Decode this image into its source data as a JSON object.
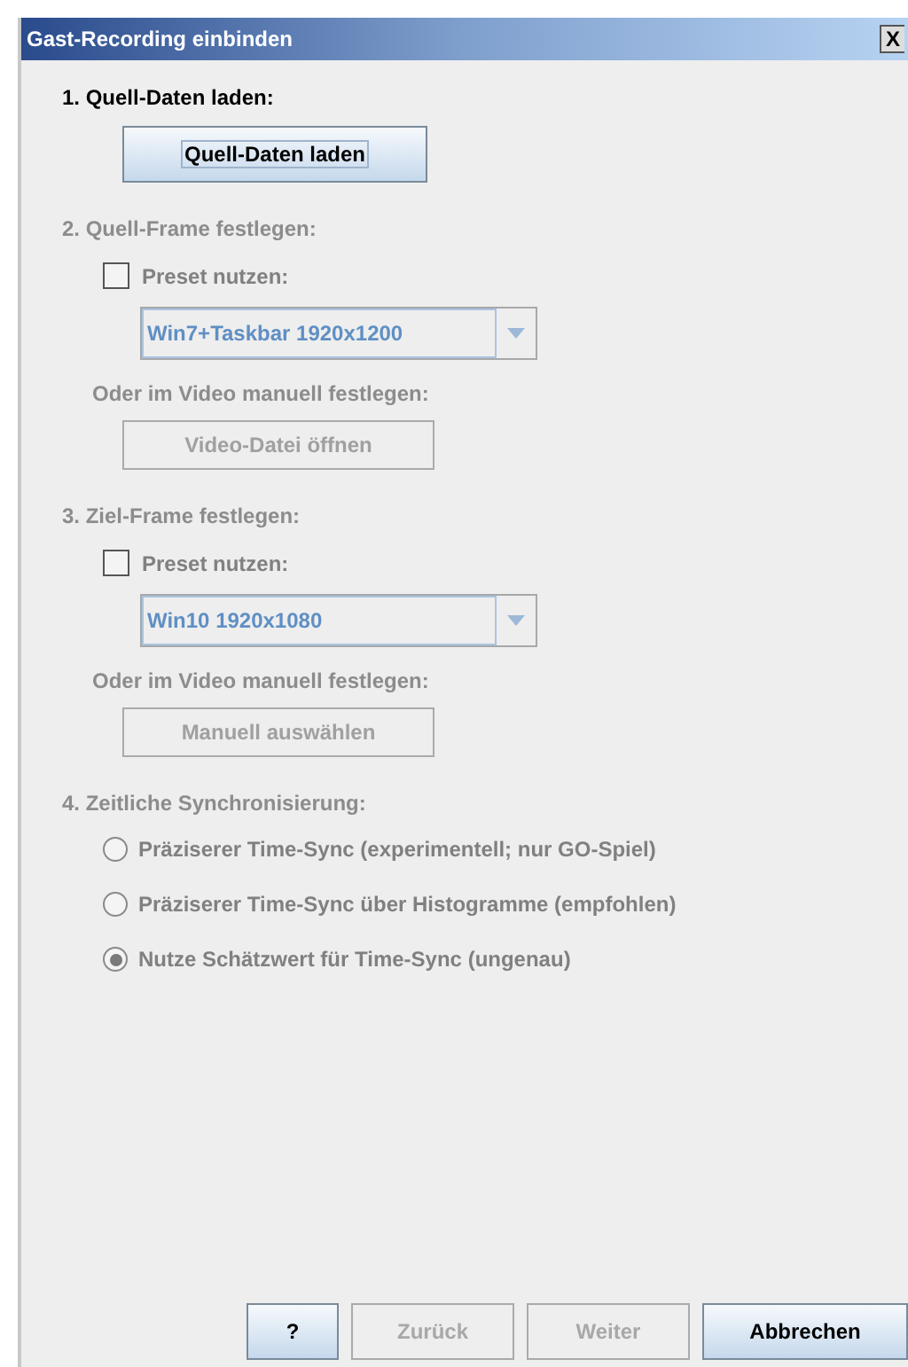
{
  "window": {
    "title": "Gast-Recording einbinden",
    "close": "X"
  },
  "sections": [
    {
      "kind": "load",
      "heading": "1. Quell-Daten laden:",
      "disabled": false,
      "button": "Quell-Daten laden"
    },
    {
      "kind": "frame",
      "heading": "2. Quell-Frame festlegen:",
      "disabled": true,
      "preset": {
        "label": "Preset nutzen:",
        "checked": false
      },
      "combo": "Win7+Taskbar 1920x1200",
      "hint": "Oder im Video manuell festlegen:",
      "button": "Video-Datei öffnen"
    },
    {
      "kind": "frame",
      "heading": "3. Ziel-Frame festlegen:",
      "disabled": true,
      "preset": {
        "label": "Preset nutzen:",
        "checked": false
      },
      "combo": "Win10 1920x1080",
      "hint": "Oder im Video manuell festlegen:",
      "button": "Manuell auswählen"
    },
    {
      "kind": "radios",
      "heading": "4. Zeitliche Synchronisierung:",
      "disabled": true,
      "options": [
        {
          "label": "Präziserer Time-Sync (experimentell; nur GO-Spiel)",
          "selected": false
        },
        {
          "label": "Präziserer Time-Sync über Histogramme (empfohlen)",
          "selected": false
        },
        {
          "label": "Nutze Schätzwert für Time-Sync (ungenau)",
          "selected": true
        }
      ]
    }
  ],
  "buttons": [
    {
      "label": "?",
      "disabled": false
    },
    {
      "label": "Zurück",
      "disabled": true
    },
    {
      "label": "Weiter",
      "disabled": true
    },
    {
      "label": "Abbrechen",
      "disabled": false
    }
  ]
}
